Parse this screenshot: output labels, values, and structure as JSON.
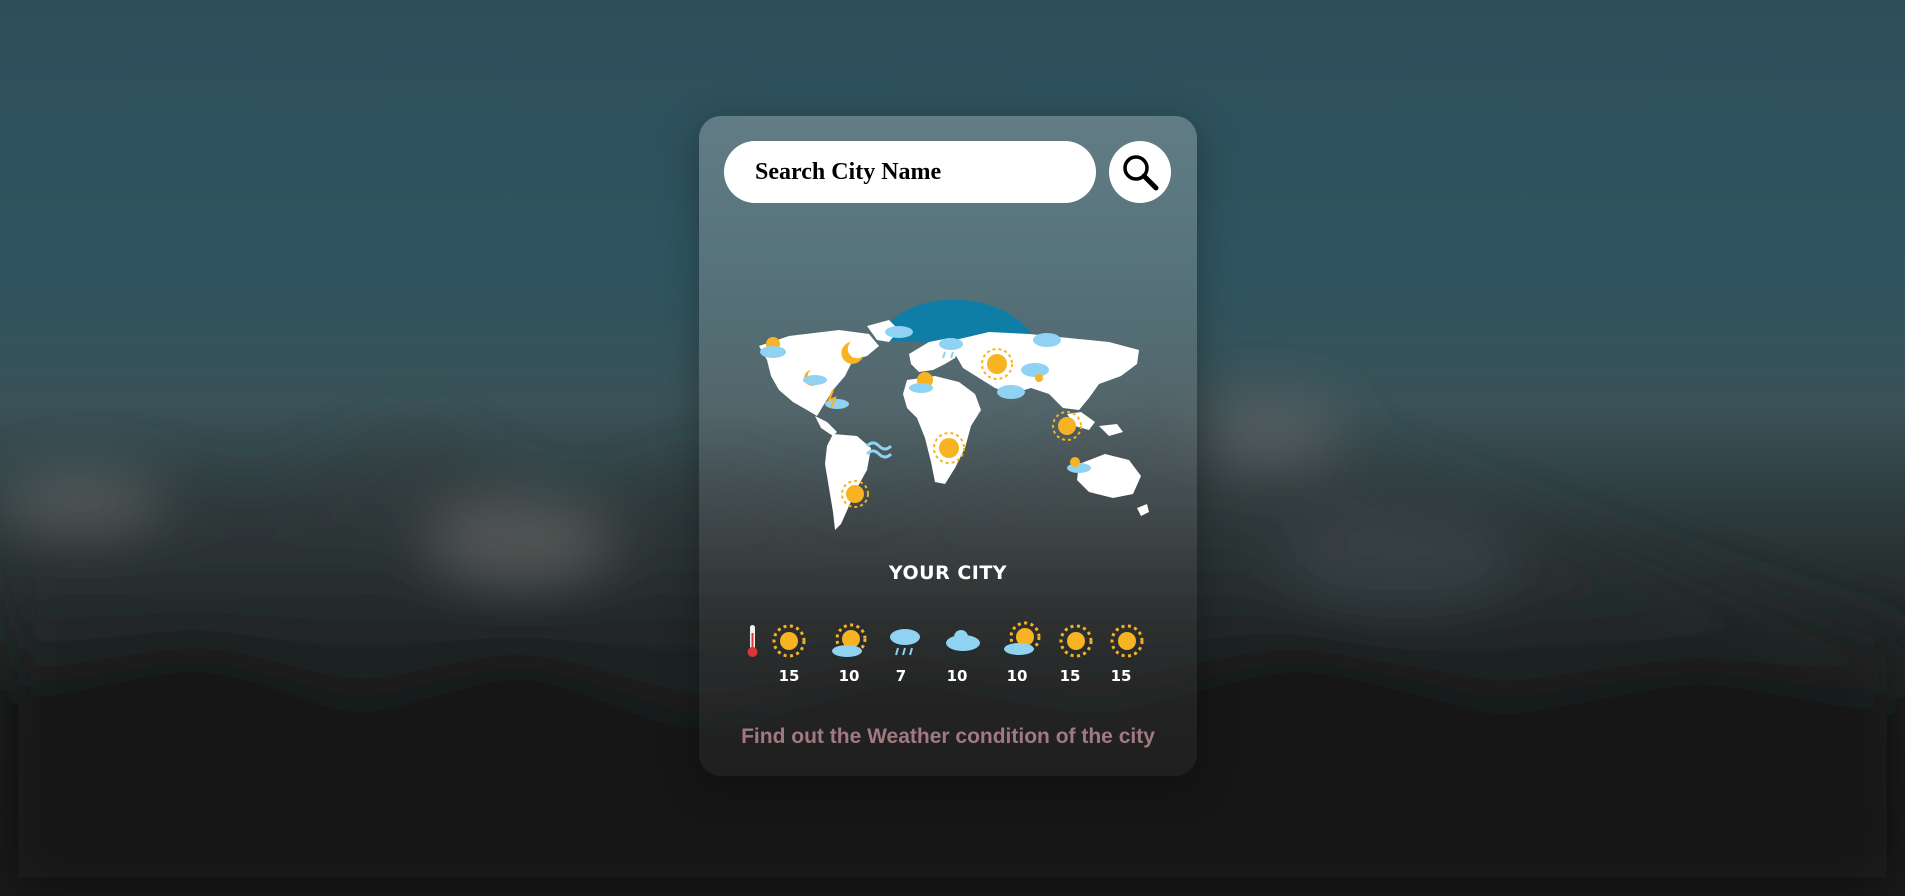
{
  "search": {
    "placeholder": "Search City Name"
  },
  "icons": {
    "search": "search-icon",
    "map": "world-weather-map-illustration",
    "thermometer": "thermometer-icon"
  },
  "city": {
    "name": "YOUR CITY"
  },
  "forecast": [
    {
      "icon": "sun-icon",
      "temp": "15"
    },
    {
      "icon": "partly-sunny-icon",
      "temp": "10"
    },
    {
      "icon": "rain-cloud-icon",
      "temp": "7"
    },
    {
      "icon": "cloud-icon",
      "temp": "10"
    },
    {
      "icon": "sun-behind-cloud-icon",
      "temp": "10"
    },
    {
      "icon": "sun-icon",
      "temp": "15"
    },
    {
      "icon": "sun-icon",
      "temp": "15"
    }
  ],
  "footer": {
    "text": "Find out the Weather condition of the city"
  },
  "colors": {
    "card_glass": "#8ca0a5",
    "footer_text": "#a07a80",
    "globe_blue": "#0e7ea6",
    "sun": "#f7b321"
  }
}
